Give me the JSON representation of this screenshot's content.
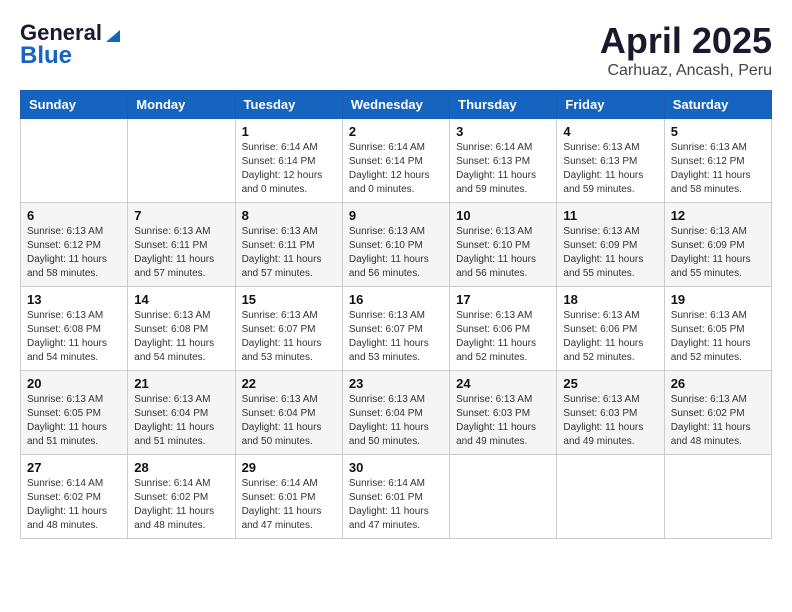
{
  "header": {
    "logo_general": "General",
    "logo_blue": "Blue",
    "title": "April 2025",
    "subtitle": "Carhuaz, Ancash, Peru"
  },
  "calendar": {
    "days_of_week": [
      "Sunday",
      "Monday",
      "Tuesday",
      "Wednesday",
      "Thursday",
      "Friday",
      "Saturday"
    ],
    "weeks": [
      [
        {
          "day": "",
          "info": ""
        },
        {
          "day": "",
          "info": ""
        },
        {
          "day": "1",
          "info": "Sunrise: 6:14 AM\nSunset: 6:14 PM\nDaylight: 12 hours\nand 0 minutes."
        },
        {
          "day": "2",
          "info": "Sunrise: 6:14 AM\nSunset: 6:14 PM\nDaylight: 12 hours\nand 0 minutes."
        },
        {
          "day": "3",
          "info": "Sunrise: 6:14 AM\nSunset: 6:13 PM\nDaylight: 11 hours\nand 59 minutes."
        },
        {
          "day": "4",
          "info": "Sunrise: 6:13 AM\nSunset: 6:13 PM\nDaylight: 11 hours\nand 59 minutes."
        },
        {
          "day": "5",
          "info": "Sunrise: 6:13 AM\nSunset: 6:12 PM\nDaylight: 11 hours\nand 58 minutes."
        }
      ],
      [
        {
          "day": "6",
          "info": "Sunrise: 6:13 AM\nSunset: 6:12 PM\nDaylight: 11 hours\nand 58 minutes."
        },
        {
          "day": "7",
          "info": "Sunrise: 6:13 AM\nSunset: 6:11 PM\nDaylight: 11 hours\nand 57 minutes."
        },
        {
          "day": "8",
          "info": "Sunrise: 6:13 AM\nSunset: 6:11 PM\nDaylight: 11 hours\nand 57 minutes."
        },
        {
          "day": "9",
          "info": "Sunrise: 6:13 AM\nSunset: 6:10 PM\nDaylight: 11 hours\nand 56 minutes."
        },
        {
          "day": "10",
          "info": "Sunrise: 6:13 AM\nSunset: 6:10 PM\nDaylight: 11 hours\nand 56 minutes."
        },
        {
          "day": "11",
          "info": "Sunrise: 6:13 AM\nSunset: 6:09 PM\nDaylight: 11 hours\nand 55 minutes."
        },
        {
          "day": "12",
          "info": "Sunrise: 6:13 AM\nSunset: 6:09 PM\nDaylight: 11 hours\nand 55 minutes."
        }
      ],
      [
        {
          "day": "13",
          "info": "Sunrise: 6:13 AM\nSunset: 6:08 PM\nDaylight: 11 hours\nand 54 minutes."
        },
        {
          "day": "14",
          "info": "Sunrise: 6:13 AM\nSunset: 6:08 PM\nDaylight: 11 hours\nand 54 minutes."
        },
        {
          "day": "15",
          "info": "Sunrise: 6:13 AM\nSunset: 6:07 PM\nDaylight: 11 hours\nand 53 minutes."
        },
        {
          "day": "16",
          "info": "Sunrise: 6:13 AM\nSunset: 6:07 PM\nDaylight: 11 hours\nand 53 minutes."
        },
        {
          "day": "17",
          "info": "Sunrise: 6:13 AM\nSunset: 6:06 PM\nDaylight: 11 hours\nand 52 minutes."
        },
        {
          "day": "18",
          "info": "Sunrise: 6:13 AM\nSunset: 6:06 PM\nDaylight: 11 hours\nand 52 minutes."
        },
        {
          "day": "19",
          "info": "Sunrise: 6:13 AM\nSunset: 6:05 PM\nDaylight: 11 hours\nand 52 minutes."
        }
      ],
      [
        {
          "day": "20",
          "info": "Sunrise: 6:13 AM\nSunset: 6:05 PM\nDaylight: 11 hours\nand 51 minutes."
        },
        {
          "day": "21",
          "info": "Sunrise: 6:13 AM\nSunset: 6:04 PM\nDaylight: 11 hours\nand 51 minutes."
        },
        {
          "day": "22",
          "info": "Sunrise: 6:13 AM\nSunset: 6:04 PM\nDaylight: 11 hours\nand 50 minutes."
        },
        {
          "day": "23",
          "info": "Sunrise: 6:13 AM\nSunset: 6:04 PM\nDaylight: 11 hours\nand 50 minutes."
        },
        {
          "day": "24",
          "info": "Sunrise: 6:13 AM\nSunset: 6:03 PM\nDaylight: 11 hours\nand 49 minutes."
        },
        {
          "day": "25",
          "info": "Sunrise: 6:13 AM\nSunset: 6:03 PM\nDaylight: 11 hours\nand 49 minutes."
        },
        {
          "day": "26",
          "info": "Sunrise: 6:13 AM\nSunset: 6:02 PM\nDaylight: 11 hours\nand 48 minutes."
        }
      ],
      [
        {
          "day": "27",
          "info": "Sunrise: 6:14 AM\nSunset: 6:02 PM\nDaylight: 11 hours\nand 48 minutes."
        },
        {
          "day": "28",
          "info": "Sunrise: 6:14 AM\nSunset: 6:02 PM\nDaylight: 11 hours\nand 48 minutes."
        },
        {
          "day": "29",
          "info": "Sunrise: 6:14 AM\nSunset: 6:01 PM\nDaylight: 11 hours\nand 47 minutes."
        },
        {
          "day": "30",
          "info": "Sunrise: 6:14 AM\nSunset: 6:01 PM\nDaylight: 11 hours\nand 47 minutes."
        },
        {
          "day": "",
          "info": ""
        },
        {
          "day": "",
          "info": ""
        },
        {
          "day": "",
          "info": ""
        }
      ]
    ]
  }
}
